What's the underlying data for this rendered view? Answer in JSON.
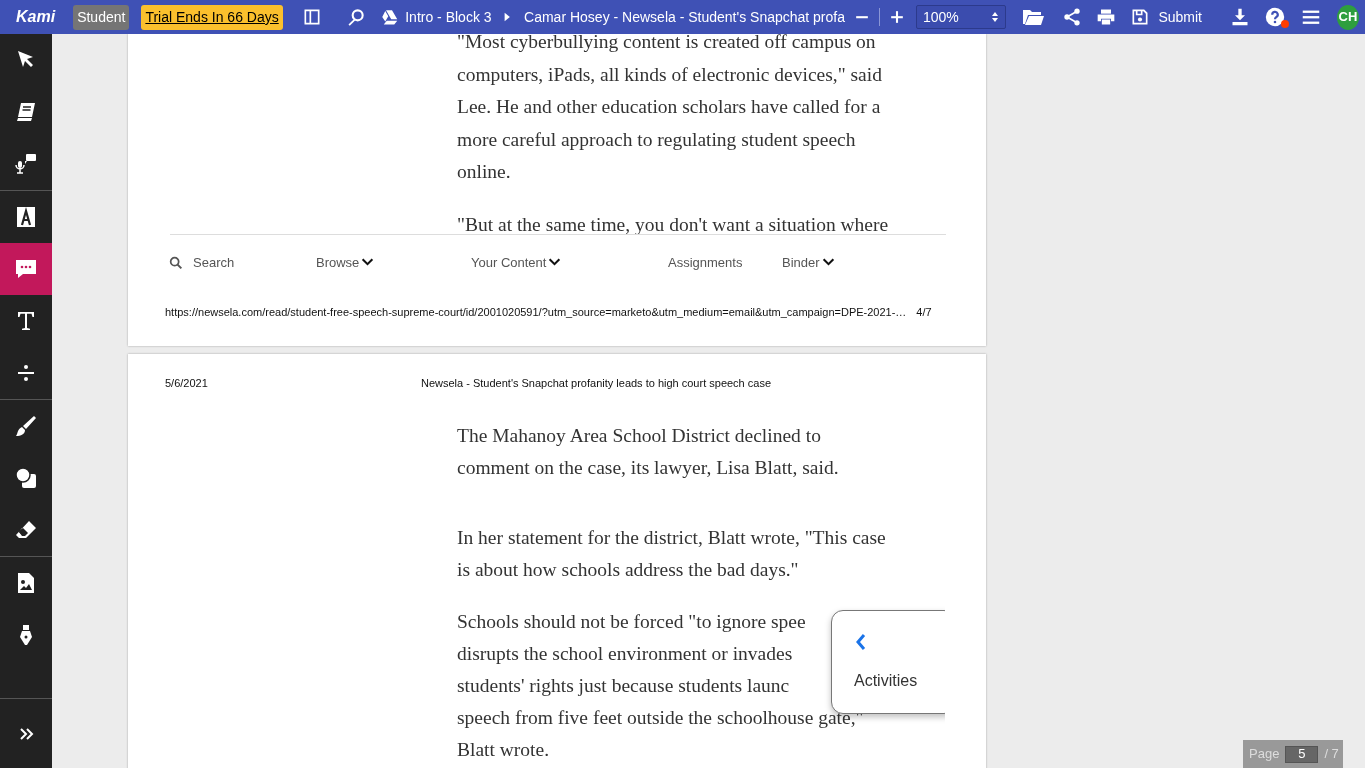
{
  "toolbar": {
    "logo": "Kami",
    "role_badge": "Student",
    "trial_link": "Trial Ends In 66 Days",
    "breadcrumb": [
      {
        "label": "Intro - Block 3"
      },
      {
        "label": "Camar Hosey - Newsela - Student's Snapchat profa"
      }
    ],
    "zoom": "100%",
    "submit": "Submit",
    "help_notification": true,
    "avatar": "CH"
  },
  "sidebar": {
    "groups": [
      [
        {
          "kind": "select",
          "selected": false
        },
        {
          "kind": "reader",
          "selected": false
        },
        {
          "kind": "audio-comment",
          "selected": false
        }
      ],
      [
        {
          "kind": "highlight",
          "selected": false
        },
        {
          "kind": "comment",
          "selected": true
        },
        {
          "kind": "text",
          "selected": false
        },
        {
          "kind": "equation",
          "selected": false
        }
      ],
      [
        {
          "kind": "brush",
          "selected": false
        },
        {
          "kind": "shape",
          "selected": false
        },
        {
          "kind": "eraser",
          "selected": false
        }
      ],
      [
        {
          "kind": "image",
          "selected": false
        },
        {
          "kind": "signature",
          "selected": false
        }
      ]
    ]
  },
  "pages": [
    {
      "paragraphs": [
        {
          "lines": [
            "\"Most cyberbullying content is created off campus on",
            "computers, iPads, all kinds of electronic devices,\" said",
            "Lee. He and other education scholars have called for a",
            "more careful approach to regulating student speech",
            "online."
          ]
        },
        {
          "lines": [
            "\"But at the same time, you don't want a situation where"
          ]
        }
      ],
      "site_nav": [
        {
          "label": "Search",
          "kind": "search"
        },
        {
          "label": "Browse",
          "kind": "dropdown"
        },
        {
          "label": "Your Content",
          "kind": "dropdown"
        },
        {
          "label": "Assignments",
          "kind": "link"
        },
        {
          "label": "Binder",
          "kind": "dropdown"
        }
      ],
      "url": "https://newsela.com/read/student-free-speech-supreme-court/id/2001020591/?utm_source=marketo&utm_medium=email&utm_campaign=DPE-2021-…",
      "page_number": "4/7"
    },
    {
      "date": "5/6/2021",
      "title": "Newsela - Student's Snapchat profanity leads to high court speech case",
      "paragraphs": [
        {
          "lines": [
            "The Mahanoy Area School District declined to",
            "comment on the case, its lawyer, Lisa Blatt, said."
          ]
        },
        {
          "lines": [
            "In her statement for the district, Blatt wrote, \"This case",
            "is about how schools address the bad days.\""
          ]
        },
        {
          "lines": [
            "Schools should not be forced \"to ignore spee",
            "disrupts the school environment or invades",
            "students' rights just because students launc",
            "speech from five feet outside the schoolhouse gate,\"",
            "Blatt wrote."
          ]
        }
      ]
    }
  ],
  "activities_panel": {
    "label": "Activities"
  },
  "page_indicator": {
    "label": "Page",
    "value": "5",
    "total": "/ 7"
  }
}
